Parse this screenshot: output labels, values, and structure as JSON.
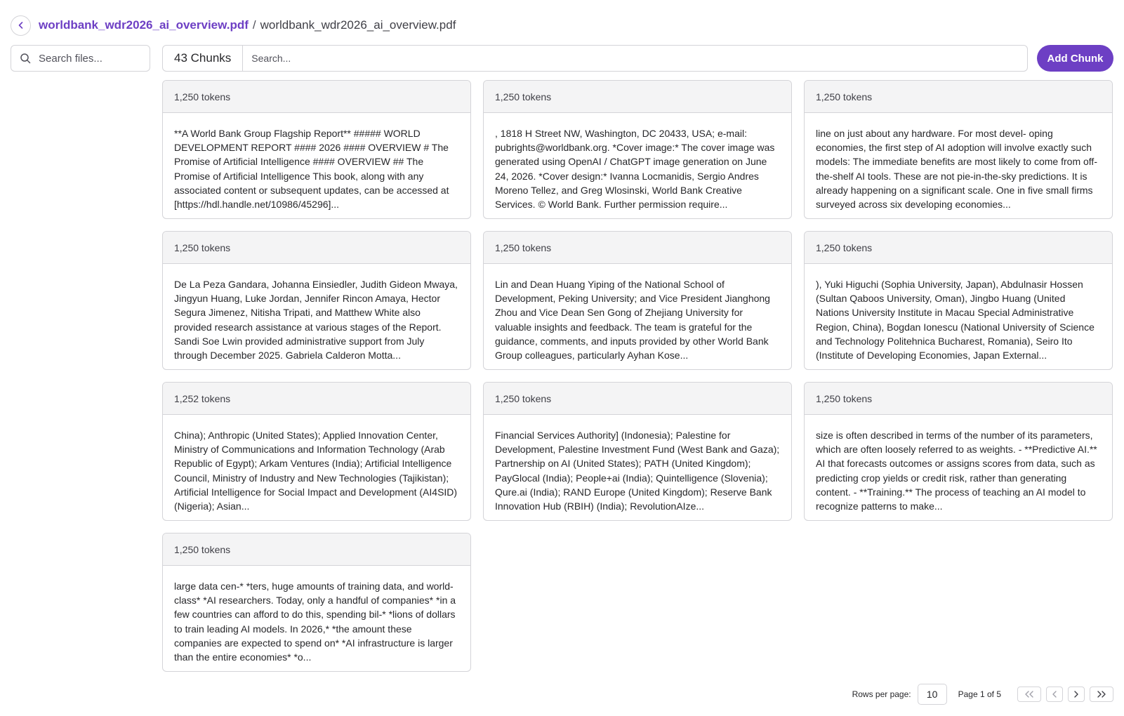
{
  "header": {
    "back_icon": "chevron-left-icon",
    "breadcrumb_link": "worldbank_wdr2026_ai_overview.pdf",
    "separator": "/",
    "breadcrumb_current": "worldbank_wdr2026_ai_overview.pdf"
  },
  "file_search": {
    "icon": "search-icon",
    "placeholder": "Search files..."
  },
  "chunks_toolbar": {
    "count_label": "43 Chunks",
    "search_placeholder": "Search...",
    "add_button": "Add Chunk"
  },
  "colors": {
    "accent": "#6d3fc4",
    "border": "#d4d4d8",
    "card_header_bg": "#f4f4f5"
  },
  "chunks": [
    {
      "tokens": "1,250 tokens",
      "text": "**A World Bank Group Flagship Report** ##### WORLD DEVELOPMENT REPORT #### 2026 #### OVERVIEW # The Promise of Artificial Intelligence #### OVERVIEW ## The Promise of Artificial Intelligence This book, along with any associated content or subsequent updates, can be accessed at [https://hdl.handle.net/10986/45296]..."
    },
    {
      "tokens": "1,250 tokens",
      "text": ", 1818 H Street NW, Washington, DC 20433, USA; e-mail: pubrights@worldbank.org. *Cover image:* The cover image was generated using OpenAI / ChatGPT image generation on June 24, 2026. *Cover design:* Ivanna Locmanidis, Sergio Andres Moreno Tellez, and Greg Wlosinski, World Bank Creative Services. © World Bank. Further permission require..."
    },
    {
      "tokens": "1,250 tokens",
      "text": "line on just about any hardware. For most devel- oping economies, the first step of AI adoption will involve exactly such models: The immediate benefits are most likely to come from off-the-shelf AI tools. These are not pie-in-the-sky predictions. It is already happening on a significant scale. One in five small firms surveyed across six developing economies..."
    },
    {
      "tokens": "1,250 tokens",
      "text": "De La Peza Gandara, Johanna Einsiedler, Judith Gideon Mwaya, Jingyun Huang, Luke Jordan, Jennifer Rincon Amaya, Hector Segura Jimenez, Nitisha Tripati, and Matthew White also provided research assistance at various stages of the Report. Sandi Soe Lwin provided administrative support from July through December 2025. Gabriela Calderon Motta..."
    },
    {
      "tokens": "1,250 tokens",
      "text": "Lin and Dean Huang Yiping of the National School of Development, Peking University; and Vice President Jianghong Zhou and Vice Dean Sen Gong of Zhejiang University for valuable insights and feedback. The team is grateful for the guidance, comments, and inputs provided by other World Bank Group colleagues, particularly Ayhan Kose..."
    },
    {
      "tokens": "1,250 tokens",
      "text": "), Yuki Higuchi (Sophia University, Japan), Abdulnasir Hossen (Sultan Qaboos University, Oman), Jingbo Huang (United Nations University Institute in Macau Special Administrative Region, China), Bogdan Ionescu (National University of Science and Technology Politehnica Bucharest, Romania), Seiro Ito (Institute of Developing Economies, Japan External..."
    },
    {
      "tokens": "1,252 tokens",
      "text": "China); Anthropic (United  States); Applied Innovation Center, Ministry of Communications and Information Technology (Arab Republic of Egypt); Arkam Ventures (India); Artificial Intelligence Council, Ministry of Industry and New Technologies (Tajikistan); Artificial Intelligence for Social Impact and Development (AI4SID) (Nigeria); Asian..."
    },
    {
      "tokens": "1,250 tokens",
      "text": "Financial Services Authority] (Indonesia); Palestine for Development, Palestine Investment Fund (West Bank and Gaza); Partnership on AI (United States); PATH (United Kingdom); PayGlocal (India); People+ai (India); Quintelligence (Slovenia); Qure.ai (India); RAND Europe (United Kingdom); Reserve Bank Innovation Hub (RBIH) (India); RevolutionAIze..."
    },
    {
      "tokens": "1,250 tokens",
      "text": "size is often described in terms of the number of its parameters, which are often loosely referred to as weights. - **Predictive AI.** AI that forecasts outcomes or assigns scores from data, such as predicting crop yields or credit risk, rather than generating content. - **Training.** The process of teaching an AI model to recognize patterns to make..."
    },
    {
      "tokens": "1,250 tokens",
      "text": "large data cen-* *ters, huge amounts of training data, and world-class* *AI researchers. Today, only a handful of companies* *in a few countries can afford to do this, spending bil-* *lions of dollars to train leading AI models. In 2026,* *the amount these companies are expected to spend on* *AI infrastructure is larger than the entire economies* *o..."
    }
  ],
  "pagination": {
    "rows_label": "Rows per page:",
    "rows_value": "10",
    "page_label": "Page 1 of 5",
    "current_page": 1,
    "total_pages": 5
  }
}
